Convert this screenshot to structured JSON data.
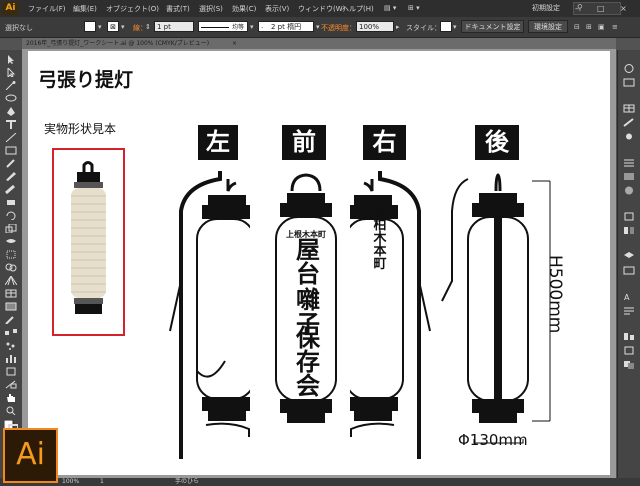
{
  "app": {
    "logo": "Ai"
  },
  "menu": {
    "items": [
      "ファイル(F)",
      "編集(E)",
      "オブジェクト(O)",
      "書式(T)",
      "選択(S)",
      "効果(C)",
      "表示(V)",
      "ウィンドウ(W)",
      "ヘルプ(H)"
    ],
    "workspace": "初期設定",
    "window_controls": [
      "–",
      "□",
      "×"
    ]
  },
  "control": {
    "selection": "選択なし",
    "stroke_label": "線：",
    "stroke_width": "1 pt",
    "uniform": "均等",
    "brush": "2 pt 楕円",
    "opacity_label": "不透明度：",
    "opacity": "100%",
    "style_label": "スタイル：",
    "doc_setup": "ドキュメント設定",
    "prefs": "環境設定"
  },
  "document": {
    "tab": "2016年_弓張り提灯_ワークシート.ai @ 100% (CMYK/プレビュー)"
  },
  "artwork": {
    "title": "弓張り提灯",
    "sample_label": "実物形状見本",
    "views": [
      "左",
      "前",
      "右",
      "後"
    ],
    "front_text": [
      "屋台",
      "囃子",
      "保存会"
    ],
    "front_small": "上根木本町",
    "side_text": "上柏木本町",
    "height_label": "H500mm",
    "width_label": "Φ130mm"
  },
  "status": {
    "zoom": "100%",
    "page": "1",
    "tool": "手のひら"
  },
  "colors": {
    "accent": "#f08a1c",
    "ui_dark": "#2e2e2e",
    "panel": "#454545",
    "sample_border": "#d2232a"
  }
}
